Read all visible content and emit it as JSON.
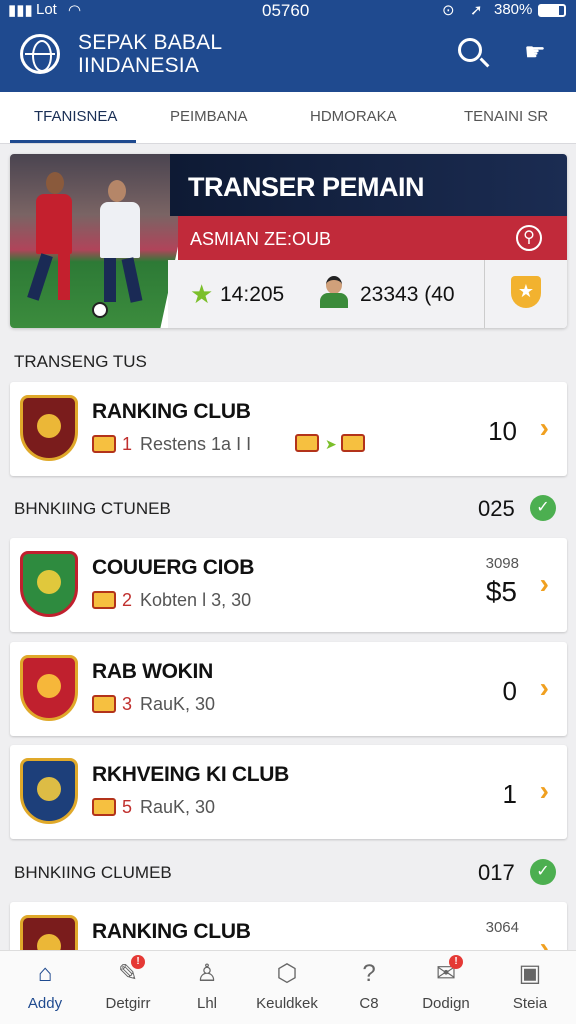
{
  "status_bar": {
    "carrier": "Lot",
    "time": "05760",
    "battery": "380%"
  },
  "header": {
    "title_line1": "SEPAK BABAL",
    "title_line2": "IINDANESIA",
    "icons": [
      "globe-logo-icon",
      "search-icon",
      "hand-icon"
    ]
  },
  "tabs": [
    {
      "label": "TFANISNEA",
      "active": true
    },
    {
      "label": "PEIMBANA",
      "active": false
    },
    {
      "label": "HDMORAKA",
      "active": false
    },
    {
      "label": "TENAINI SR",
      "active": false
    }
  ],
  "banner": {
    "title": "TRANSER PEMAIN",
    "subtitle": "ASMIAN ZE:OUB",
    "stat1": "14:205",
    "stat2": "23343 (40"
  },
  "sections": [
    {
      "label": "TRANSENG TUS"
    },
    {
      "label": "BHNKIING CTUNEB",
      "value": "025"
    },
    {
      "label": "BHNKIING CLUMEB",
      "value": "017"
    }
  ],
  "clubs": [
    {
      "name": "RANKING CLUB",
      "rank": "1",
      "subtitle": "Restens 1a I I",
      "value": "10",
      "crest_color": "#7a1c1c"
    },
    {
      "name": "COUUERG CIOB",
      "rank": "2",
      "subtitle": "Kobten l 3, 30",
      "top_value": "3098",
      "value": "$5",
      "crest_color": "#2e8b3f"
    },
    {
      "name": "RAB WOKIN",
      "rank": "3",
      "subtitle": "RauK, 30",
      "value": "0",
      "crest_color": "#c0202e"
    },
    {
      "name": "RKHVEING KI CLUB",
      "rank": "5",
      "subtitle": "RauK, 30",
      "value": "1",
      "crest_color": "#1d3f7a"
    },
    {
      "name": "RANKING CLUB",
      "top_value": "3064",
      "crest_color": "#7a1c1c"
    }
  ],
  "bottom_nav": [
    {
      "label": "Addy",
      "icon": "home-icon",
      "active": true,
      "badge": false
    },
    {
      "label": "Detgirr",
      "icon": "whistle-icon",
      "active": false,
      "badge": true
    },
    {
      "label": "Lhl",
      "icon": "person-icon",
      "active": false,
      "badge": false
    },
    {
      "label": "Keuldkek",
      "icon": "ball-icon",
      "active": false,
      "badge": false
    },
    {
      "label": "C8",
      "icon": "question-icon",
      "active": false,
      "badge": false
    },
    {
      "label": "Dodign",
      "icon": "mail-icon",
      "active": false,
      "badge": true
    },
    {
      "label": "Steia",
      "icon": "chat-icon",
      "active": false,
      "badge": false
    }
  ],
  "colors": {
    "primary": "#1f4a8f",
    "accent_red": "#c12a3a",
    "chevron": "#f0a020",
    "check": "#4caf50"
  }
}
